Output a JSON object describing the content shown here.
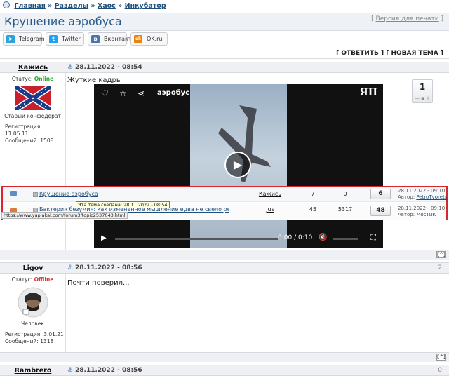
{
  "breadcrumb": {
    "items": [
      "Главная",
      "Разделы",
      "Хаос",
      "Инкубатор"
    ],
    "sep": "»"
  },
  "page_title": "Крушение аэробуса",
  "print_link": "Версия для печати",
  "share": [
    {
      "label": "Telegram",
      "icon": "telegram-icon",
      "color": "#2aa3dd",
      "glyph": "➤"
    },
    {
      "label": "Twitter",
      "icon": "twitter-icon",
      "color": "#1da1f2",
      "glyph": "t"
    },
    {
      "label": "Вконтакте",
      "icon": "vk-icon",
      "color": "#4a76a8",
      "glyph": "в"
    },
    {
      "label": "OK.ru",
      "icon": "ok-icon",
      "color": "#ee8208",
      "glyph": "ok"
    }
  ],
  "actions": {
    "reply": "[ ОТВЕТИТЬ ]",
    "new_topic": "[ НОВАЯ ТЕМА ]"
  },
  "posts": [
    {
      "author": "Кажись",
      "date": "28.11.2022 - 08:54",
      "status_label": "Статус:",
      "status": "Online",
      "rank": "Старый конфедерат",
      "reg": "Регистрация: 11.05.11",
      "msgs": "Сообщений: 1508",
      "text": "Жуткие кадры",
      "rating": "1",
      "vote_pm": "— ▪ +"
    },
    {
      "author": "Ligov",
      "date": "28.11.2022 - 08:56",
      "num": "2",
      "status_label": "Статус:",
      "status": "Offline",
      "rank": "Человек",
      "reg": "Регистрация: 3.01.21",
      "msgs": "Сообщений: 1318",
      "text": "Почти поверил..."
    },
    {
      "author": "Rambrero",
      "date": "28.11.2022 - 08:56",
      "num": "0"
    }
  ],
  "video": {
    "title": "аэробус",
    "time": "0:00 / 0:10",
    "logo": "ЯП"
  },
  "overlay_rows": [
    {
      "title": "Крушение аэробуса",
      "author": "Кажись",
      "replies": "7",
      "views": "0",
      "rating": "6",
      "last_date": "28.11.2022 - 09:10",
      "last_author_label": "Автор:",
      "last_author": "PetroTvorets"
    },
    {
      "title": "Бактерия безумия: как изменённое мышление едва не свело ребёнка с",
      "author": "Jus",
      "replies": "45",
      "views": "5317",
      "rating": "48",
      "last_date": "28.11.2022 - 09:10",
      "last_author_label": "Автор:",
      "last_author": "МосТиК"
    }
  ],
  "tooltip": "Эта тема создана: 28.11.2022 - 08:54",
  "status_url": "https://www.yaplakal.com/forum3/topic2537043.html",
  "to_top": "[^]"
}
